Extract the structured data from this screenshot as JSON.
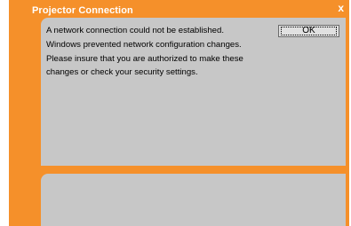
{
  "dialog": {
    "title": "Projector Connection",
    "close_glyph": "x",
    "message_lines": [
      "A network connection could not be established.",
      "Windows prevented network configuration changes.",
      "Please insure that you are authorized to make these",
      "changes or check your security settings."
    ],
    "ok_label": "OK"
  },
  "colors": {
    "frame": "#f5902a",
    "panel": "#c7c7c7",
    "title_text": "#ffffff"
  }
}
